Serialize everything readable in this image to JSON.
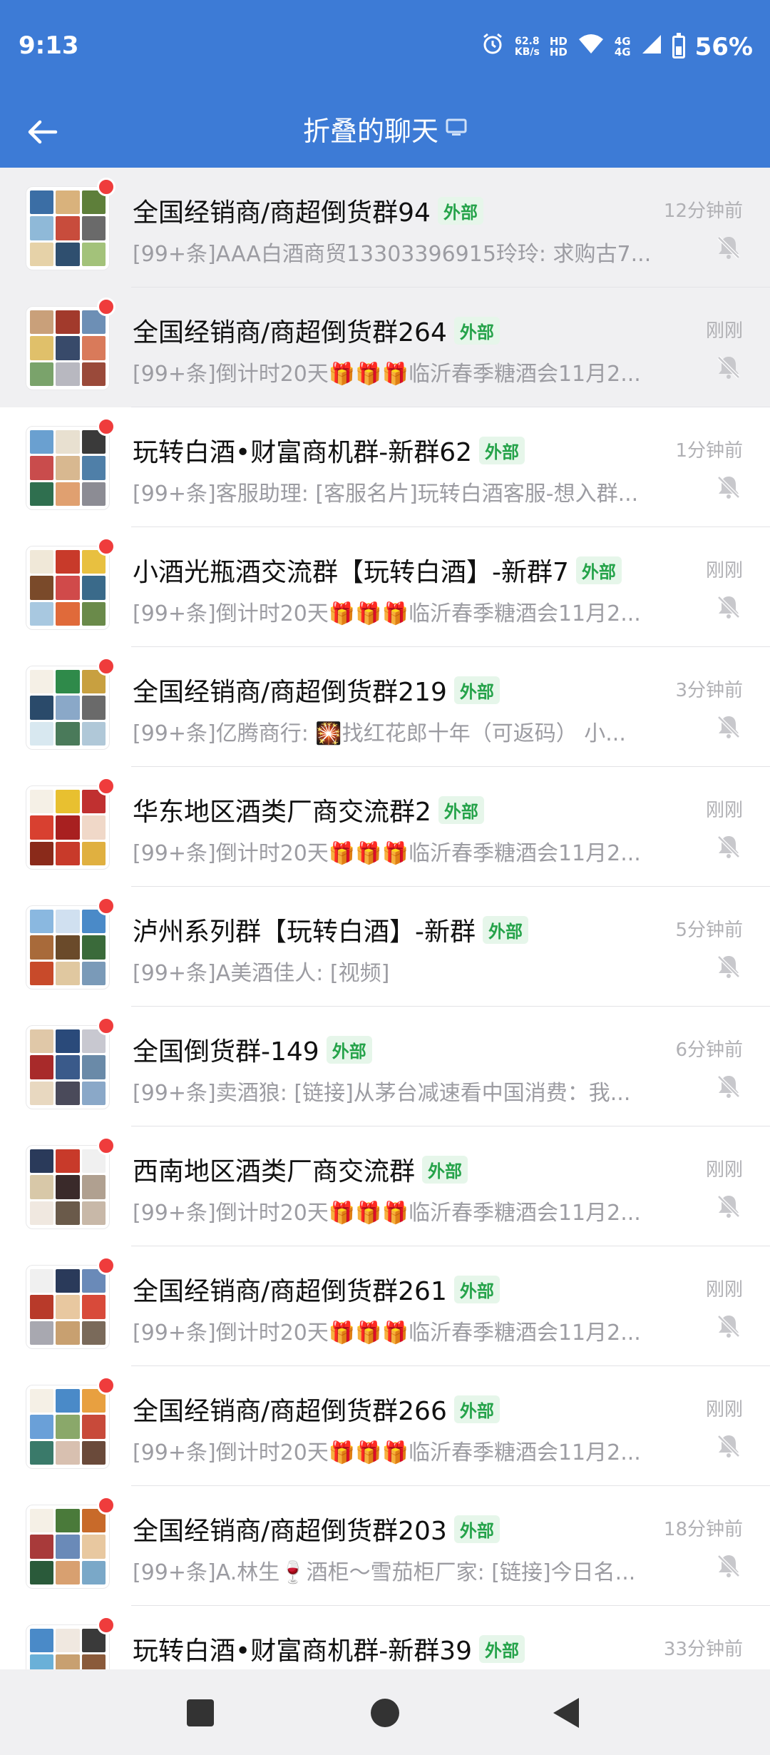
{
  "status_bar": {
    "time": "9:13",
    "net_speed_value": "62.8",
    "net_speed_unit": "KB/s",
    "hd_top": "HD",
    "hd_bottom": "HD",
    "sim1": "4G",
    "sim2": "4G",
    "battery": "56%"
  },
  "header": {
    "title": "折叠的聊天",
    "bg_color": "#3d7bd6"
  },
  "tag_label": "外部",
  "chats": [
    {
      "name": "全国经销商/商超倒货群94",
      "time": "12分钟前",
      "preview": "[99+条]AAA白酒商贸13303396915玲玲: 求购古7...",
      "pinned": true
    },
    {
      "name": "全国经销商/商超倒货群264",
      "time": "刚刚",
      "preview": "[99+条]倒计时20天🎁🎁🎁临沂春季糖酒会11月2...",
      "pinned": true
    },
    {
      "name": "玩转白酒•财富商机群-新群62",
      "time": "1分钟前",
      "preview": "[99+条]客服助理: [客服名片]玩转白酒客服-想入群...",
      "pinned": false
    },
    {
      "name": "小酒光瓶酒交流群【玩转白酒】-新群7",
      "time": "刚刚",
      "preview": "[99+条]倒计时20天🎁🎁🎁临沂春季糖酒会11月2...",
      "pinned": false
    },
    {
      "name": "全国经销商/商超倒货群219",
      "time": "3分钟前",
      "preview": "[99+条]亿腾商行: 🎇找红花郎十年（可返码） 小...",
      "pinned": false
    },
    {
      "name": "华东地区酒类厂商交流群2",
      "time": "刚刚",
      "preview": "[99+条]倒计时20天🎁🎁🎁临沂春季糖酒会11月2...",
      "pinned": false
    },
    {
      "name": "泸州系列群【玩转白酒】-新群",
      "time": "5分钟前",
      "preview": "[99+条]A美酒佳人: [视频]",
      "pinned": false
    },
    {
      "name": "全国倒货群-149",
      "time": "6分钟前",
      "preview": "[99+条]卖酒狼: [链接]从茅台减速看中国消费：我...",
      "pinned": false
    },
    {
      "name": "西南地区酒类厂商交流群",
      "time": "刚刚",
      "preview": "[99+条]倒计时20天🎁🎁🎁临沂春季糖酒会11月2...",
      "pinned": false
    },
    {
      "name": "全国经销商/商超倒货群261",
      "time": "刚刚",
      "preview": "[99+条]倒计时20天🎁🎁🎁临沂春季糖酒会11月2...",
      "pinned": false
    },
    {
      "name": "全国经销商/商超倒货群266",
      "time": "刚刚",
      "preview": "[99+条]倒计时20天🎁🎁🎁临沂春季糖酒会11月2...",
      "pinned": false
    },
    {
      "name": "全国经销商/商超倒货群203",
      "time": "18分钟前",
      "preview": "[99+条]A.林生🍷酒柜～雪茄柜厂家: [链接]今日名...",
      "pinned": false
    },
    {
      "name": "玩转白酒•财富商机群-新群39",
      "time": "33分钟前",
      "preview": "",
      "pinned": false
    }
  ],
  "colors": {
    "tag_text": "#25a34a",
    "tag_bg": "#e6f6ea",
    "unread_dot": "#ef3c3c",
    "pinned_bg": "#f0f0f2"
  }
}
